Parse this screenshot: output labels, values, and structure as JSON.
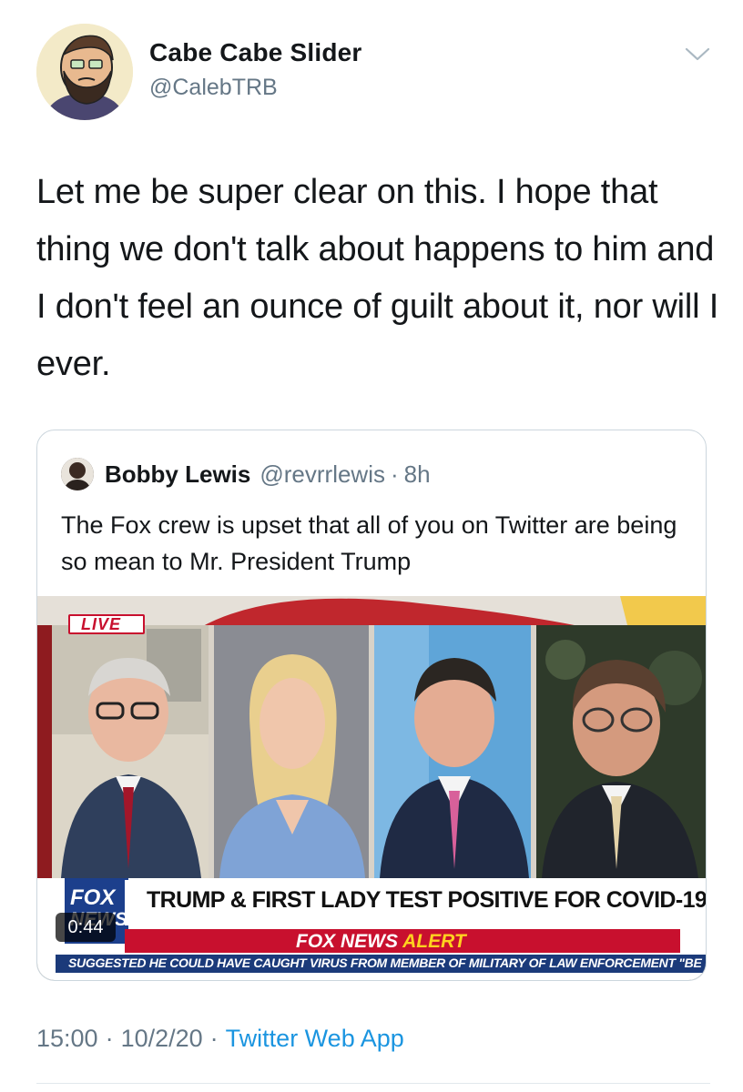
{
  "tweet": {
    "author": {
      "display_name": "Cabe Cabe Slider",
      "handle": "@CalebTRB",
      "avatar_icon": "cartoon-avatar"
    },
    "menu_icon": "chevron-down-icon",
    "text": "Let me be super clear on this. I hope that thing we don't talk about happens to him and I don't feel an ounce of guilt about it, nor will I ever.",
    "timestamp_time": "15:00",
    "timestamp_date": "10/2/20",
    "separator": "·",
    "source": "Twitter Web App"
  },
  "quoted_tweet": {
    "author": {
      "display_name": "Bobby Lewis",
      "handle": "@revrrlewis",
      "separator": "·",
      "time_ago": "8h"
    },
    "text": "The Fox crew is upset that all of you on Twitter are being so mean to Mr. President Trump",
    "video": {
      "live_badge": "LIVE",
      "logo_line1": "FOX",
      "logo_line2": "NEWS",
      "headline": "TRUMP & FIRST LADY TEST POSITIVE FOR COVID-19",
      "alert_prefix": "FOX NEWS",
      "alert_suffix": "ALERT",
      "ticker": "SUGGESTED HE COULD HAVE CAUGHT VIRUS FROM MEMBER OF MILITARY OF LAW ENFORCEMENT \"BE",
      "duration": "0:44"
    }
  },
  "colors": {
    "link_blue": "#1b95e0",
    "secondary_text": "#657786",
    "fox_red": "#c8102e",
    "fox_blue": "#1c3f8c"
  }
}
